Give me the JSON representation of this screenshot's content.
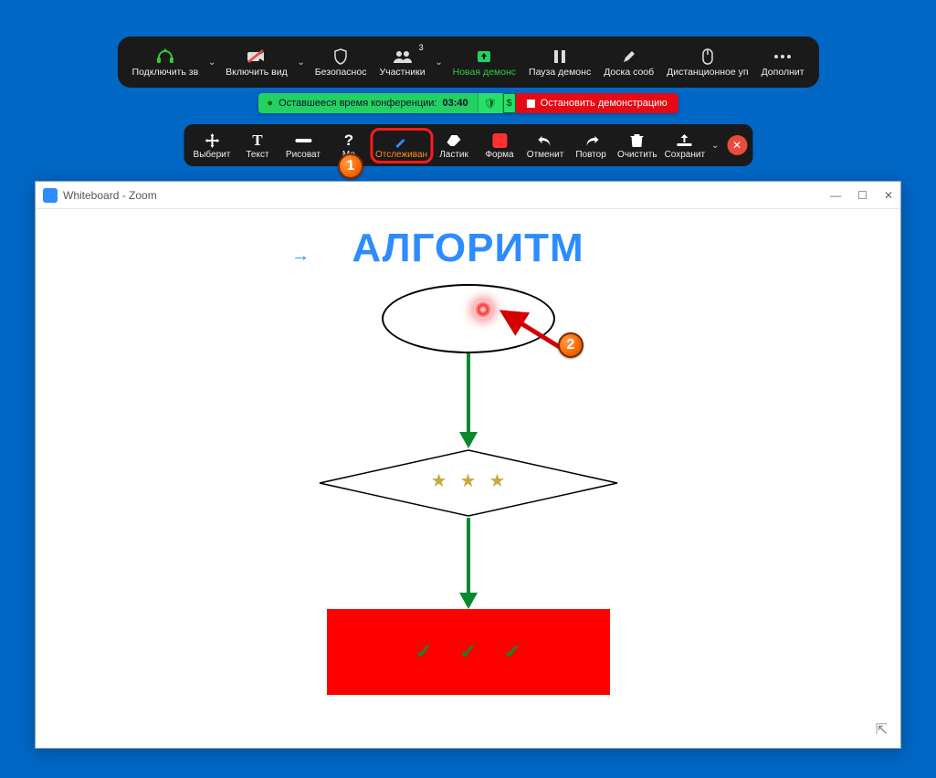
{
  "main_toolbar": {
    "audio": "Подключить зв",
    "video": "Включить вид",
    "security": "Безопаснос",
    "participants": "Участники",
    "participants_count": "3",
    "new_share": "Новая демонс",
    "pause_share": "Пауза демонс",
    "whiteboard": "Доска сооб",
    "remote": "Дистанционное уп",
    "more": "Дополнит"
  },
  "status": {
    "remaining_label": "Оставшееся время конференции:",
    "remaining_time": "03:40",
    "stop_label": "Остановить демонстрацию"
  },
  "anno": {
    "select": "Выберит",
    "text": "Текст",
    "draw": "Рисоват",
    "mark": "Ме",
    "spotlight": "Отслеживан",
    "eraser": "Ластик",
    "format": "Форма",
    "undo": "Отменит",
    "redo": "Повтор",
    "clear": "Очистить",
    "save": "Сохранит"
  },
  "window": {
    "title": "Whiteboard - Zoom"
  },
  "canvas": {
    "heading": "АЛГОРИТМ"
  },
  "markers": {
    "one": "1",
    "two": "2"
  }
}
